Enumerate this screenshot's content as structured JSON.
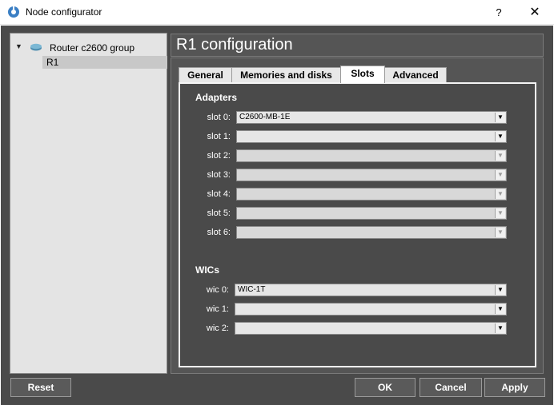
{
  "window": {
    "title": "Node configurator",
    "help_label": "?",
    "close_label": "✕"
  },
  "tree": {
    "expander": "▼",
    "group_label": "Router c2600 group",
    "items": [
      {
        "label": "R1",
        "selected": true
      }
    ]
  },
  "config": {
    "title": "R1 configuration",
    "tabs": [
      {
        "label": "General",
        "active": false
      },
      {
        "label": "Memories and disks",
        "active": false
      },
      {
        "label": "Slots",
        "active": true
      },
      {
        "label": "Advanced",
        "active": false
      }
    ],
    "adapters": {
      "title": "Adapters",
      "slots": [
        {
          "label": "slot 0:",
          "value": "C2600-MB-1E",
          "enabled": true
        },
        {
          "label": "slot 1:",
          "value": "",
          "enabled": true
        },
        {
          "label": "slot 2:",
          "value": "",
          "enabled": false
        },
        {
          "label": "slot 3:",
          "value": "",
          "enabled": false
        },
        {
          "label": "slot 4:",
          "value": "",
          "enabled": false
        },
        {
          "label": "slot 5:",
          "value": "",
          "enabled": false
        },
        {
          "label": "slot 6:",
          "value": "",
          "enabled": false
        }
      ]
    },
    "wics": {
      "title": "WICs",
      "slots": [
        {
          "label": "wic 0:",
          "value": "WIC-1T",
          "enabled": true
        },
        {
          "label": "wic 1:",
          "value": "",
          "enabled": true
        },
        {
          "label": "wic 2:",
          "value": "",
          "enabled": true
        }
      ]
    }
  },
  "buttons": {
    "reset": "Reset",
    "ok": "OK",
    "cancel": "Cancel",
    "apply": "Apply"
  },
  "icons": {
    "app": "gns3-app-icon",
    "router": "router-icon",
    "dropdown": "▼"
  },
  "colors": {
    "background": "#4a4a4a",
    "panel": "#555555",
    "tree_bg": "#e4e4e4",
    "accent_icon": "#3b7fc4"
  }
}
